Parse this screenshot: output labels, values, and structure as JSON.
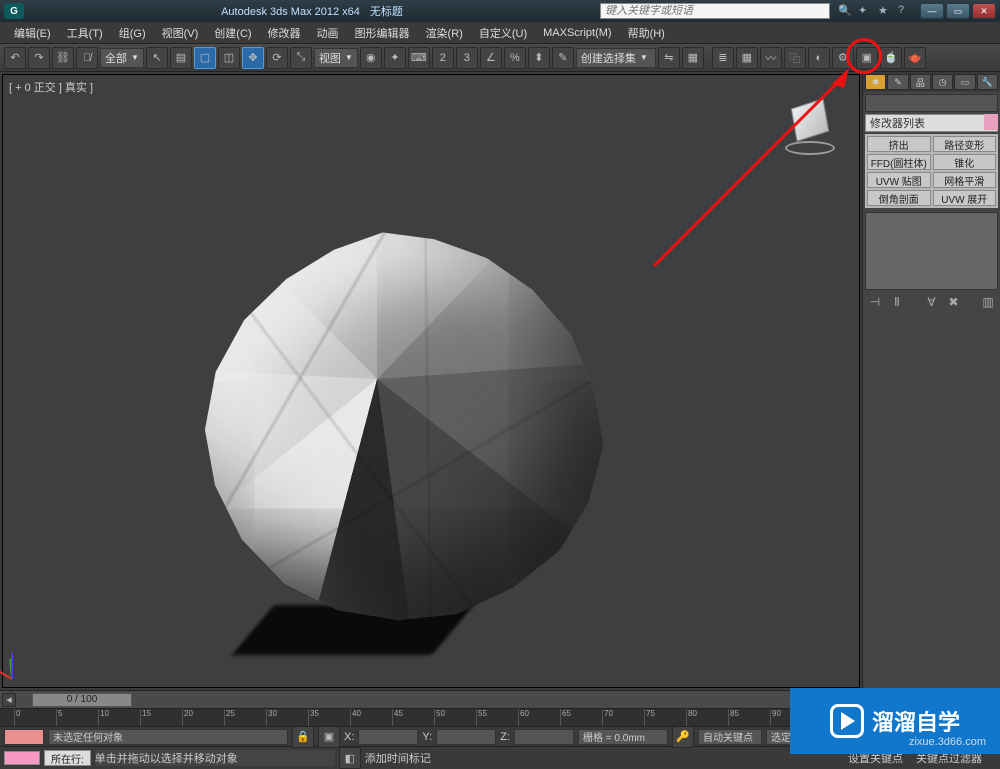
{
  "title": {
    "app": "Autodesk 3ds Max  2012  x64",
    "doc": "无标题",
    "search_placeholder": "键入关键字或短语"
  },
  "menu": [
    "编辑(E)",
    "工具(T)",
    "组(G)",
    "视图(V)",
    "创建(C)",
    "修改器",
    "动画",
    "图形编辑器",
    "渲染(R)",
    "自定义(U)",
    "MAXScript(M)",
    "帮助(H)"
  ],
  "toolbar": {
    "all_dropdown": "全部",
    "view_dropdown": "视图",
    "selset_dropdown": "创建选择集"
  },
  "viewport": {
    "label": "[ + 0 正交 ] 真实 ]"
  },
  "right_panel": {
    "mod_list": "修改器列表",
    "buttons": [
      "挤出",
      "路径变形",
      "FFD(圆柱体)",
      "锥化",
      "UVW 贴图",
      "网格平滑",
      "倒角剖面",
      "UVW 展开"
    ]
  },
  "timeline": {
    "slider": "0 / 100",
    "ticks": [
      0,
      5,
      10,
      15,
      20,
      25,
      30,
      35,
      40,
      45,
      50,
      55,
      60,
      65,
      70,
      75,
      80,
      85,
      90
    ]
  },
  "status": {
    "no_selection": "未选定任何对象",
    "x": "X:",
    "y": "Y:",
    "z": "Z:",
    "grid": "栅格 = 0.0mm",
    "autokey": "自动关键点",
    "selected": "选定对象",
    "hint": "单击并拖动以选择并移动对象",
    "add_time_tag": "添加时间标记",
    "setkey": "设置关键点",
    "keyfilter": "关键点过滤器",
    "location_label": "所在行:"
  },
  "watermark": {
    "brand": "溜溜自学",
    "sub": "zixue.3d66.com"
  }
}
